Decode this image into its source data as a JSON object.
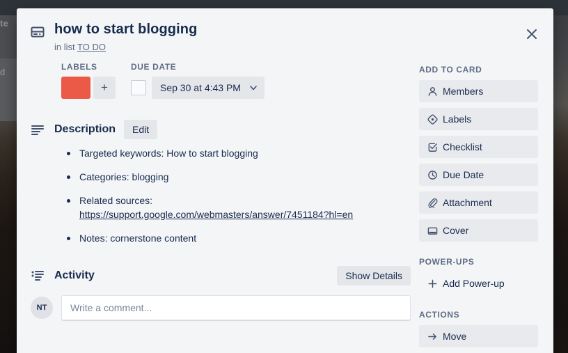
{
  "background": {
    "fragment_top": "te",
    "fragment_bottom": "d"
  },
  "card": {
    "icon": "card-icon",
    "title": "how to start blogging",
    "in_list_prefix": "in list",
    "list_name": "TO DO",
    "close_icon": "close-icon"
  },
  "meta": {
    "labels": {
      "heading": "LABELS",
      "chip_color": "#eb5a46",
      "add_label": "+"
    },
    "due_date": {
      "heading": "DUE DATE",
      "value": "Sep 30 at 4:43 PM",
      "checked": false
    }
  },
  "description": {
    "heading": "Description",
    "edit_label": "Edit",
    "items": [
      {
        "text": "Targeted keywords: How to start blogging",
        "link": null
      },
      {
        "text": "Categories: blogging",
        "link": null
      },
      {
        "text": "Related sources:",
        "link": "https://support.google.com/webmasters/answer/7451184?hl=en"
      },
      {
        "text": "Notes: cornerstone content",
        "link": null
      }
    ]
  },
  "activity": {
    "heading": "Activity",
    "show_details_label": "Show Details",
    "avatar_initials": "NT",
    "comment_placeholder": "Write a comment..."
  },
  "sidebar": {
    "add_to_card": {
      "heading": "ADD TO CARD",
      "items": [
        {
          "label": "Members",
          "icon": "person-icon"
        },
        {
          "label": "Labels",
          "icon": "tag-icon"
        },
        {
          "label": "Checklist",
          "icon": "checkbox-icon"
        },
        {
          "label": "Due Date",
          "icon": "clock-icon"
        },
        {
          "label": "Attachment",
          "icon": "paperclip-icon"
        },
        {
          "label": "Cover",
          "icon": "cover-icon"
        }
      ]
    },
    "power_ups": {
      "heading": "POWER-UPS",
      "items": [
        {
          "label": "Add Power-up",
          "icon": "plus-icon"
        }
      ]
    },
    "actions": {
      "heading": "ACTIONS",
      "items": [
        {
          "label": "Move",
          "icon": "arrow-right-icon"
        }
      ]
    }
  }
}
